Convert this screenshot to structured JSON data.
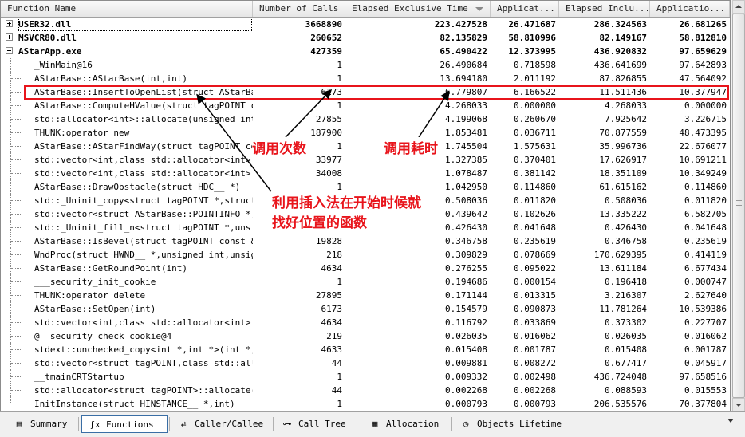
{
  "columns": [
    "Function Name",
    "Number of Calls",
    "Elapsed Exclusive Time",
    "Applicat...",
    "Elapsed Inclu...",
    "Applicatio..."
  ],
  "rows": [
    {
      "name": "USER32.dll",
      "calls": "3668890",
      "excl": "223.427528",
      "app_excl": "26.471687",
      "incl": "286.324563",
      "app_incl": "26.681265",
      "level": 0,
      "expander": "plus",
      "bold": true
    },
    {
      "name": "MSVCR80.dll",
      "calls": "260652",
      "excl": "82.135829",
      "app_excl": "58.810996",
      "incl": "82.149167",
      "app_incl": "58.812810",
      "level": 0,
      "expander": "plus",
      "bold": true
    },
    {
      "name": "AStarApp.exe",
      "calls": "427359",
      "excl": "65.490422",
      "app_excl": "12.373995",
      "incl": "436.920832",
      "app_incl": "97.659629",
      "level": 0,
      "expander": "minus",
      "bold": true
    },
    {
      "name": "_WinMain@16",
      "calls": "1",
      "excl": "26.490684",
      "app_excl": "0.718598",
      "incl": "436.641699",
      "app_incl": "97.642893",
      "level": 1
    },
    {
      "name": "AStarBase::AStarBase(int,int)",
      "calls": "1",
      "excl": "13.694180",
      "app_excl": "2.011192",
      "incl": "87.826855",
      "app_incl": "47.564092",
      "level": 1
    },
    {
      "name": "AStarBase::InsertToOpenList(struct AStarBase::",
      "calls": "6173",
      "excl": "6.779807",
      "app_excl": "6.166522",
      "incl": "11.511436",
      "app_incl": "10.377947",
      "level": 1
    },
    {
      "name": "AStarBase::ComputeHValue(struct tagPOINT const",
      "calls": "1",
      "excl": "4.268033",
      "app_excl": "0.000000",
      "incl": "4.268033",
      "app_incl": "0.000000",
      "level": 1
    },
    {
      "name": "std::allocator<int>::allocate(unsigned int)",
      "calls": "27855",
      "excl": "4.199068",
      "app_excl": "0.260670",
      "incl": "7.925642",
      "app_incl": "3.226715",
      "level": 1
    },
    {
      "name": "THUNK:operator new",
      "calls": "187900",
      "excl": "1.853481",
      "app_excl": "0.036711",
      "incl": "70.877559",
      "app_incl": "48.473395",
      "level": 1
    },
    {
      "name": "AStarBase::AStarFindWay(struct tagPOINT const",
      "calls": "1",
      "excl": "1.745504",
      "app_excl": "1.575631",
      "incl": "35.996736",
      "app_incl": "22.676077",
      "level": 1
    },
    {
      "name": "std::vector<int,class std::allocator<int> >::",
      "calls": "33977",
      "excl": "1.327385",
      "app_excl": "0.370401",
      "incl": "17.626917",
      "app_incl": "10.691211",
      "level": 1
    },
    {
      "name": "std::vector<int,class std::allocator<int> >::",
      "calls": "34008",
      "excl": "1.078487",
      "app_excl": "0.381142",
      "incl": "18.351109",
      "app_incl": "10.349249",
      "level": 1
    },
    {
      "name": "AStarBase::DrawObstacle(struct HDC__ *)",
      "calls": "1",
      "excl": "1.042950",
      "app_excl": "0.114860",
      "incl": "61.615162",
      "app_incl": "0.114860",
      "level": 1
    },
    {
      "name": "std::_Uninit_copy<struct tagPOINT *,struct ta",
      "calls": "",
      "excl": "0.508036",
      "app_excl": "0.011820",
      "incl": "0.508036",
      "app_incl": "0.011820",
      "level": 1
    },
    {
      "name": "std::vector<struct AStarBase::POINTINFO *,cla",
      "calls": "",
      "excl": "0.439642",
      "app_excl": "0.102626",
      "incl": "13.335222",
      "app_incl": "6.582705",
      "level": 1
    },
    {
      "name": "std::_Uninit_fill_n<struct tagPOINT *,unsigne",
      "calls": "",
      "excl": "0.426430",
      "app_excl": "0.041648",
      "incl": "0.426430",
      "app_incl": "0.041648",
      "level": 1
    },
    {
      "name": "AStarBase::IsBevel(struct tagPOINT const &)",
      "calls": "19828",
      "excl": "0.346758",
      "app_excl": "0.235619",
      "incl": "0.346758",
      "app_incl": "0.235619",
      "level": 1
    },
    {
      "name": "WndProc(struct HWND__ *,unsigned int,unsigned",
      "calls": "218",
      "excl": "0.309829",
      "app_excl": "0.078669",
      "incl": "170.629395",
      "app_incl": "0.414119",
      "level": 1
    },
    {
      "name": "AStarBase::GetRoundPoint(int)",
      "calls": "4634",
      "excl": "0.276255",
      "app_excl": "0.095022",
      "incl": "13.611184",
      "app_incl": "6.677434",
      "level": 1
    },
    {
      "name": "___security_init_cookie",
      "calls": "1",
      "excl": "0.194686",
      "app_excl": "0.000154",
      "incl": "0.196418",
      "app_incl": "0.000747",
      "level": 1
    },
    {
      "name": "THUNK:operator delete",
      "calls": "27895",
      "excl": "0.171144",
      "app_excl": "0.013315",
      "incl": "3.216307",
      "app_incl": "2.627640",
      "level": 1
    },
    {
      "name": "AStarBase::SetOpen(int)",
      "calls": "6173",
      "excl": "0.154579",
      "app_excl": "0.090873",
      "incl": "11.781264",
      "app_incl": "10.539386",
      "level": 1
    },
    {
      "name": "std::vector<int,class std::allocator<int> >::",
      "calls": "4634",
      "excl": "0.116792",
      "app_excl": "0.033869",
      "incl": "0.373302",
      "app_incl": "0.227707",
      "level": 1
    },
    {
      "name": "@__security_check_cookie@4",
      "calls": "219",
      "excl": "0.026035",
      "app_excl": "0.016062",
      "incl": "0.026035",
      "app_incl": "0.016062",
      "level": 1
    },
    {
      "name": "stdext::unchecked_copy<int *,int *>(int *,int",
      "calls": "4633",
      "excl": "0.015408",
      "app_excl": "0.001787",
      "incl": "0.015408",
      "app_incl": "0.001787",
      "level": 1
    },
    {
      "name": "std::vector<struct tagPOINT,class std::alloca",
      "calls": "44",
      "excl": "0.009881",
      "app_excl": "0.008272",
      "incl": "0.677417",
      "app_incl": "0.045917",
      "level": 1
    },
    {
      "name": "__tmainCRTStartup",
      "calls": "1",
      "excl": "0.009332",
      "app_excl": "0.002498",
      "incl": "436.724048",
      "app_incl": "97.658516",
      "level": 1
    },
    {
      "name": "std::allocator<struct tagPOINT>::allocate(unsi",
      "calls": "44",
      "excl": "0.002268",
      "app_excl": "0.002268",
      "incl": "0.088593",
      "app_incl": "0.015553",
      "level": 1
    },
    {
      "name": "InitInstance(struct HINSTANCE__ *,int)",
      "calls": "1",
      "excl": "0.000793",
      "app_excl": "0.000793",
      "incl": "206.535576",
      "app_incl": "70.377804",
      "level": 1
    }
  ],
  "annotations": {
    "calls": "调用次数",
    "time": "调用耗时",
    "insert_line1": "利用插入法在开始时候就",
    "insert_line2": "找好位置的函数"
  },
  "tabs": [
    {
      "label": "Summary",
      "icon": "summary-icon",
      "glyph": "▤"
    },
    {
      "label": "Functions",
      "icon": "function-icon",
      "glyph": "ƒx",
      "active": true
    },
    {
      "label": "Caller/Callee",
      "icon": "caller-callee-icon",
      "glyph": "⇄"
    },
    {
      "label": "Call Tree",
      "icon": "call-tree-icon",
      "glyph": "⊶"
    },
    {
      "label": "Allocation",
      "icon": "allocation-icon",
      "glyph": "▦"
    },
    {
      "label": "Objects Lifetime",
      "icon": "objects-lifetime-icon",
      "glyph": "◷"
    }
  ],
  "colors": {
    "annotation": "#e8141b",
    "selection_border": "#3a6ea5"
  }
}
